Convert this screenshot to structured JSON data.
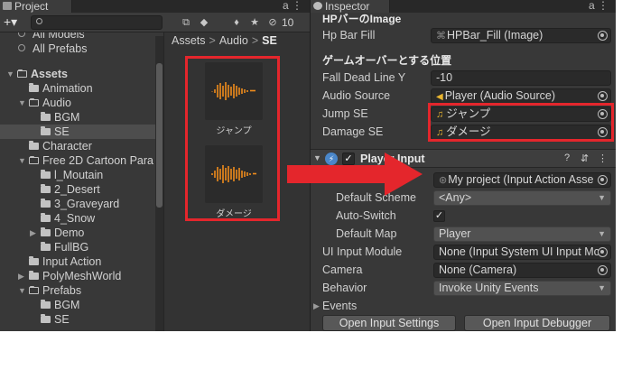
{
  "project": {
    "tab_title": "Project",
    "toolbar": {
      "add_label": "+▾",
      "hidden_count": "10"
    },
    "favorites": [
      "All Models",
      "All Prefabs"
    ],
    "tree": [
      {
        "label": "Assets",
        "depth": 0,
        "open": true,
        "bold": true
      },
      {
        "label": "Animation",
        "depth": 1
      },
      {
        "label": "Audio",
        "depth": 1,
        "open": true
      },
      {
        "label": "BGM",
        "depth": 2
      },
      {
        "label": "SE",
        "depth": 2,
        "selected": true
      },
      {
        "label": "Character",
        "depth": 1
      },
      {
        "label": "Free 2D Cartoon Para",
        "depth": 1,
        "open": true
      },
      {
        "label": "l_Moutain",
        "depth": 2
      },
      {
        "label": "2_Desert",
        "depth": 2
      },
      {
        "label": "3_Graveyard",
        "depth": 2
      },
      {
        "label": "4_Snow",
        "depth": 2
      },
      {
        "label": "Demo",
        "depth": 2,
        "collapsed": true
      },
      {
        "label": "FullBG",
        "depth": 2
      },
      {
        "label": "Input Action",
        "depth": 1
      },
      {
        "label": "PolyMeshWorld",
        "depth": 1,
        "collapsed": true
      },
      {
        "label": "Prefabs",
        "depth": 1,
        "open": true
      },
      {
        "label": "BGM",
        "depth": 2
      },
      {
        "label": "SE",
        "depth": 2
      }
    ],
    "breadcrumb": [
      "Assets",
      "Audio",
      "SE"
    ],
    "assets": [
      {
        "label": "ジャンプ"
      },
      {
        "label": "ダメージ"
      }
    ]
  },
  "inspector": {
    "tab_title": "Inspector",
    "section_hp": "HPバーのImage",
    "hp_bar_fill": {
      "label": "Hp Bar Fill",
      "value": "HPBar_Fill (Image)"
    },
    "section_gameover": "ゲームオーバーとする位置",
    "fall_dead": {
      "label": "Fall Dead Line Y",
      "value": "-10"
    },
    "audio_source": {
      "label": "Audio Source",
      "value": "Player (Audio Source)"
    },
    "jump_se": {
      "label": "Jump SE",
      "value": "ジャンプ"
    },
    "damage_se": {
      "label": "Damage SE",
      "value": "ダメージ"
    },
    "player_input": {
      "title": "Player Input",
      "actions_value": "My project (Input Action Asse",
      "default_scheme": {
        "label": "Default Scheme",
        "value": "<Any>"
      },
      "auto_switch": {
        "label": "Auto-Switch",
        "checked": "✓"
      },
      "default_map": {
        "label": "Default Map",
        "value": "Player"
      },
      "ui_input_module": {
        "label": "UI Input Module",
        "value": "None (Input System UI Input Mc"
      },
      "camera": {
        "label": "Camera",
        "value": "None (Camera)"
      },
      "behavior": {
        "label": "Behavior",
        "value": "Invoke Unity Events"
      },
      "events_label": "Events",
      "open_settings": "Open Input Settings",
      "open_debugger": "Open Input Debugger"
    }
  },
  "colors": {
    "highlight": "#e4262c",
    "audio_wave": "#f08c1c",
    "panel": "#383838"
  }
}
